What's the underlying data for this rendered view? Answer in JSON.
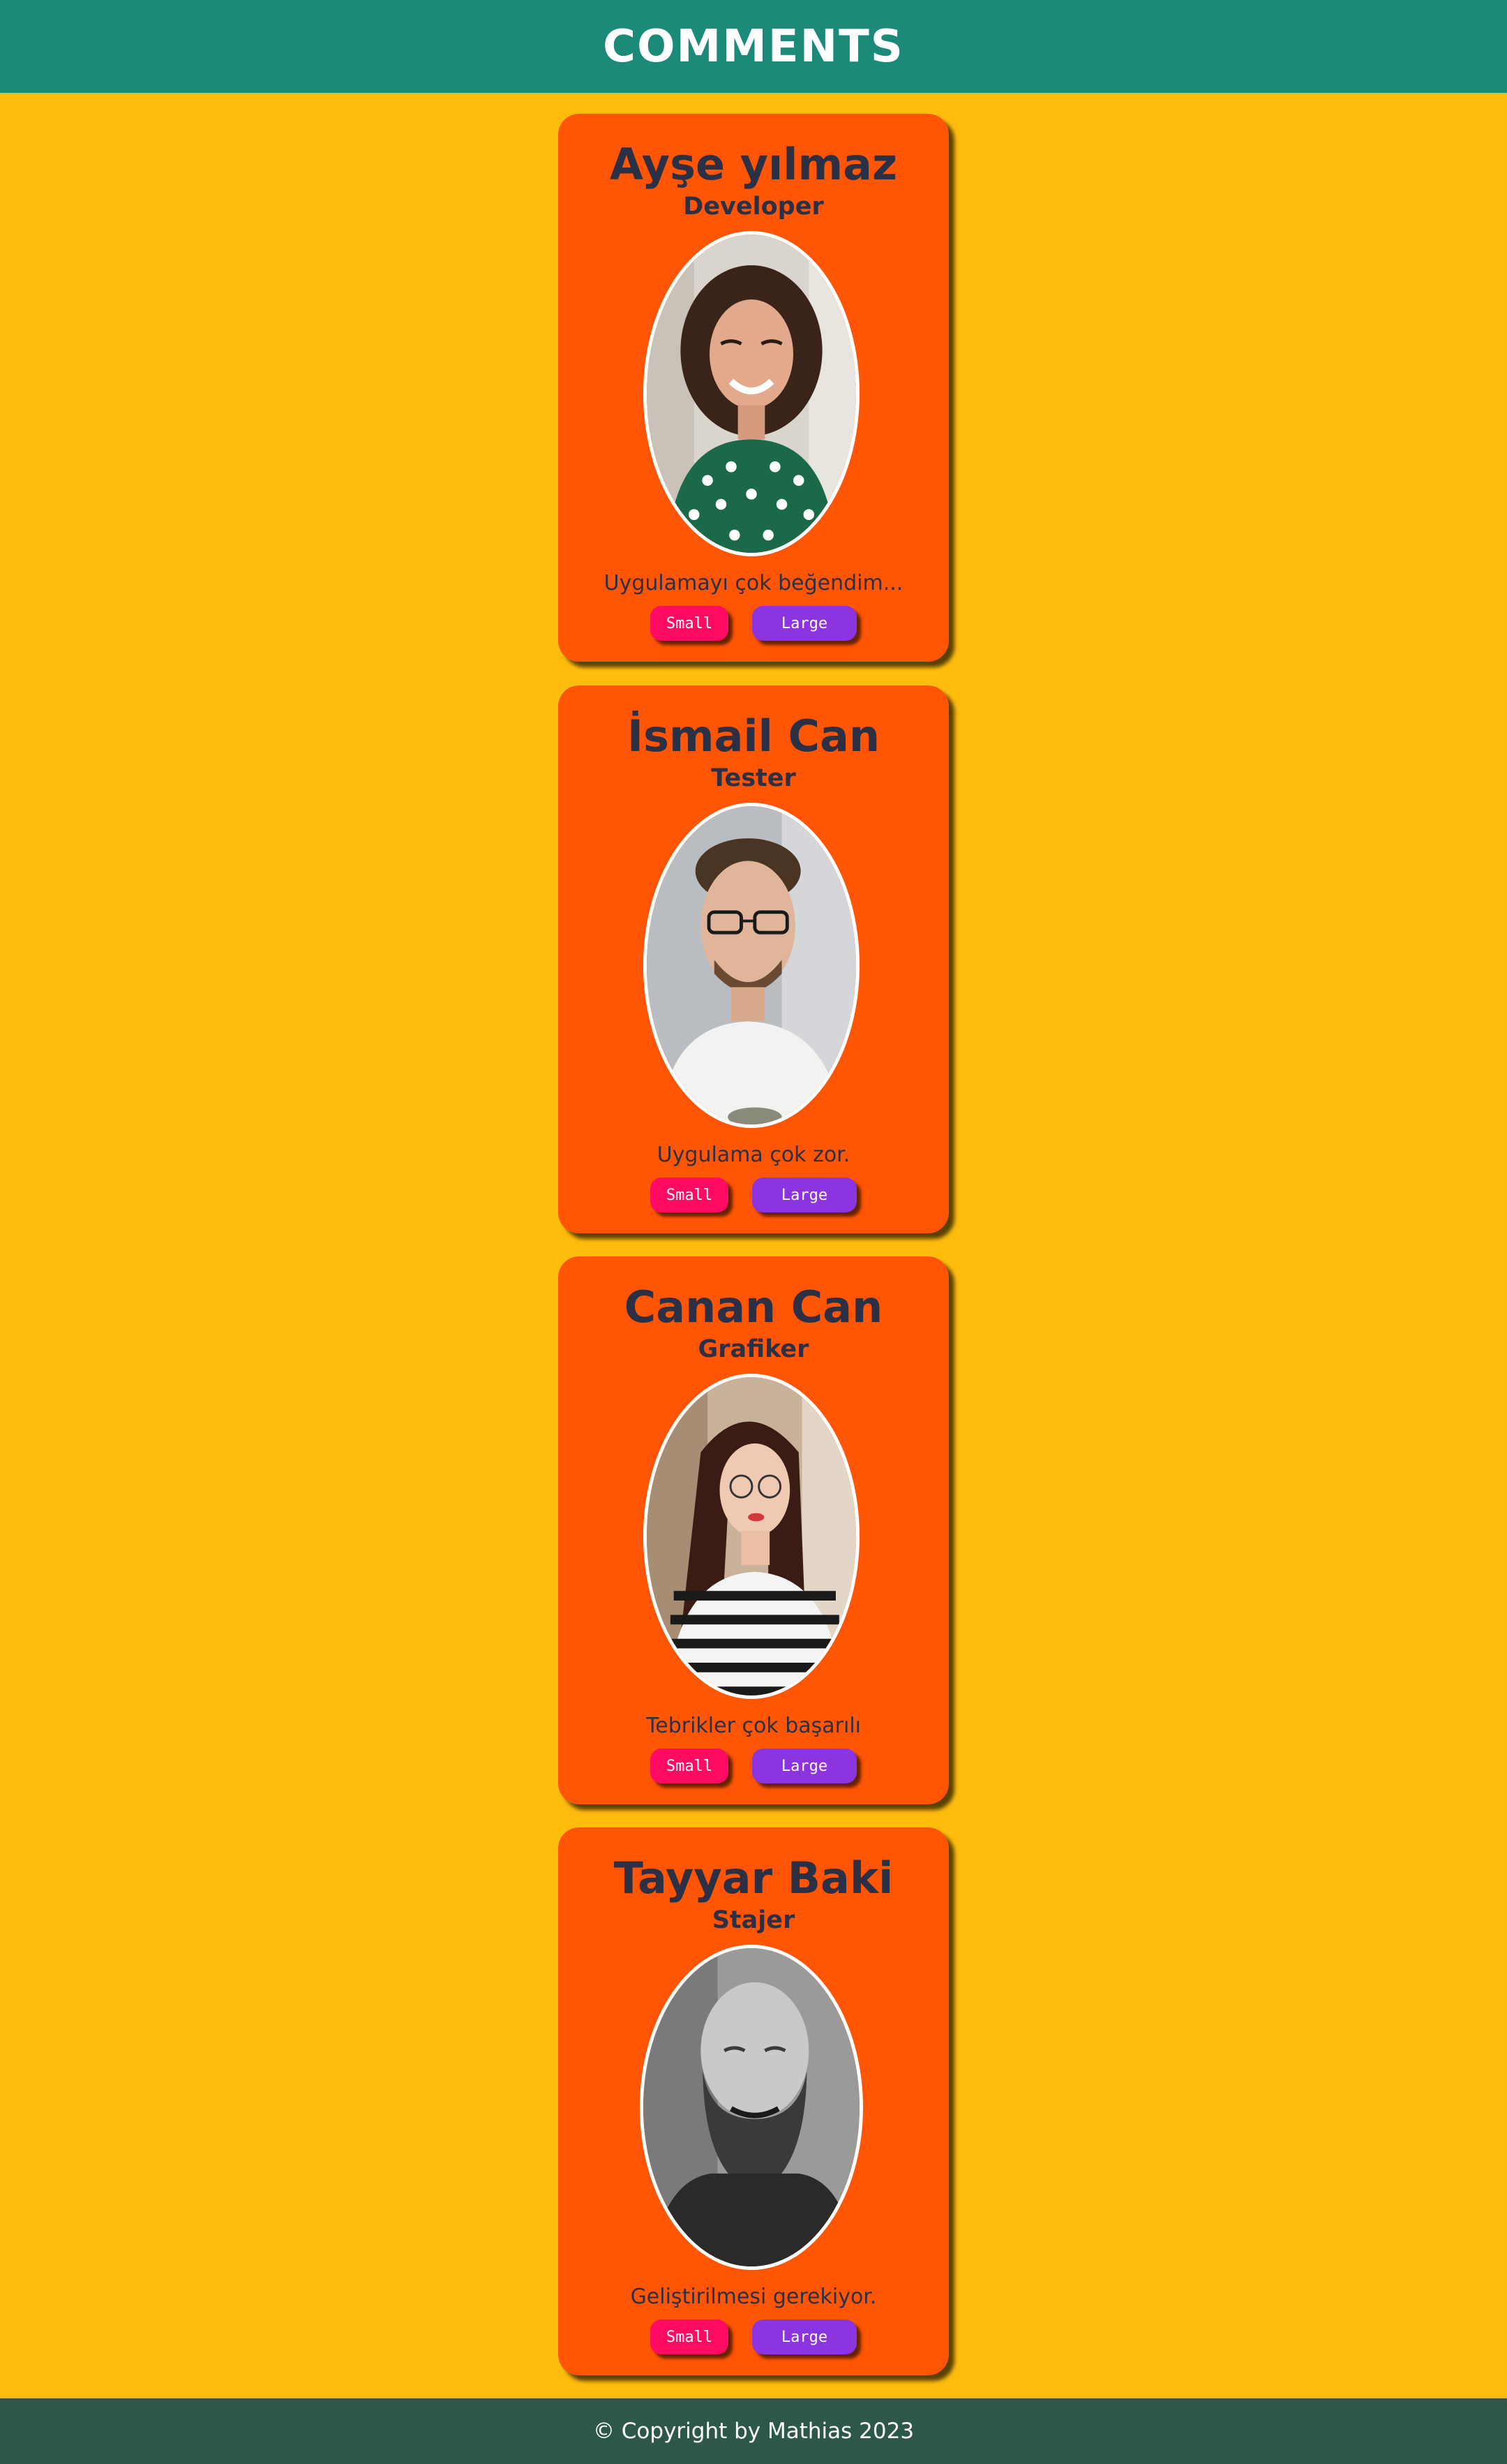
{
  "header": {
    "title": "Comments"
  },
  "cards": [
    {
      "name": "Ayşe yılmaz",
      "role": "Developer",
      "comment": "Uygulamayı çok beğendim...",
      "photo_icon": "woman-curly-hair-portrait",
      "small_label": "Small",
      "large_label": "Large"
    },
    {
      "name": "İsmail Can",
      "role": "Tester",
      "comment": "Uygulama çok zor.",
      "photo_icon": "man-glasses-portrait",
      "small_label": "Small",
      "large_label": "Large"
    },
    {
      "name": "Canan Can",
      "role": "Grafiker",
      "comment": "Tebrikler çok başarılı",
      "photo_icon": "woman-glasses-portrait",
      "small_label": "Small",
      "large_label": "Large"
    },
    {
      "name": "Tayyar Baki",
      "role": "Stajer",
      "comment": "Geliştirilmesi gerekiyor.",
      "photo_icon": "bearded-man-portrait",
      "small_label": "Small",
      "large_label": "Large"
    }
  ],
  "footer": {
    "copyright": "© Copyright by Mathias 2023"
  },
  "colors": {
    "page_background": "#ffbc0d",
    "header_background": "#1c8a79",
    "card_background": "#ff5504",
    "small_button": "#ff0b63",
    "large_button": "#8c34e0",
    "footer_background": "#2d5848",
    "card_text": "#2b3044"
  }
}
